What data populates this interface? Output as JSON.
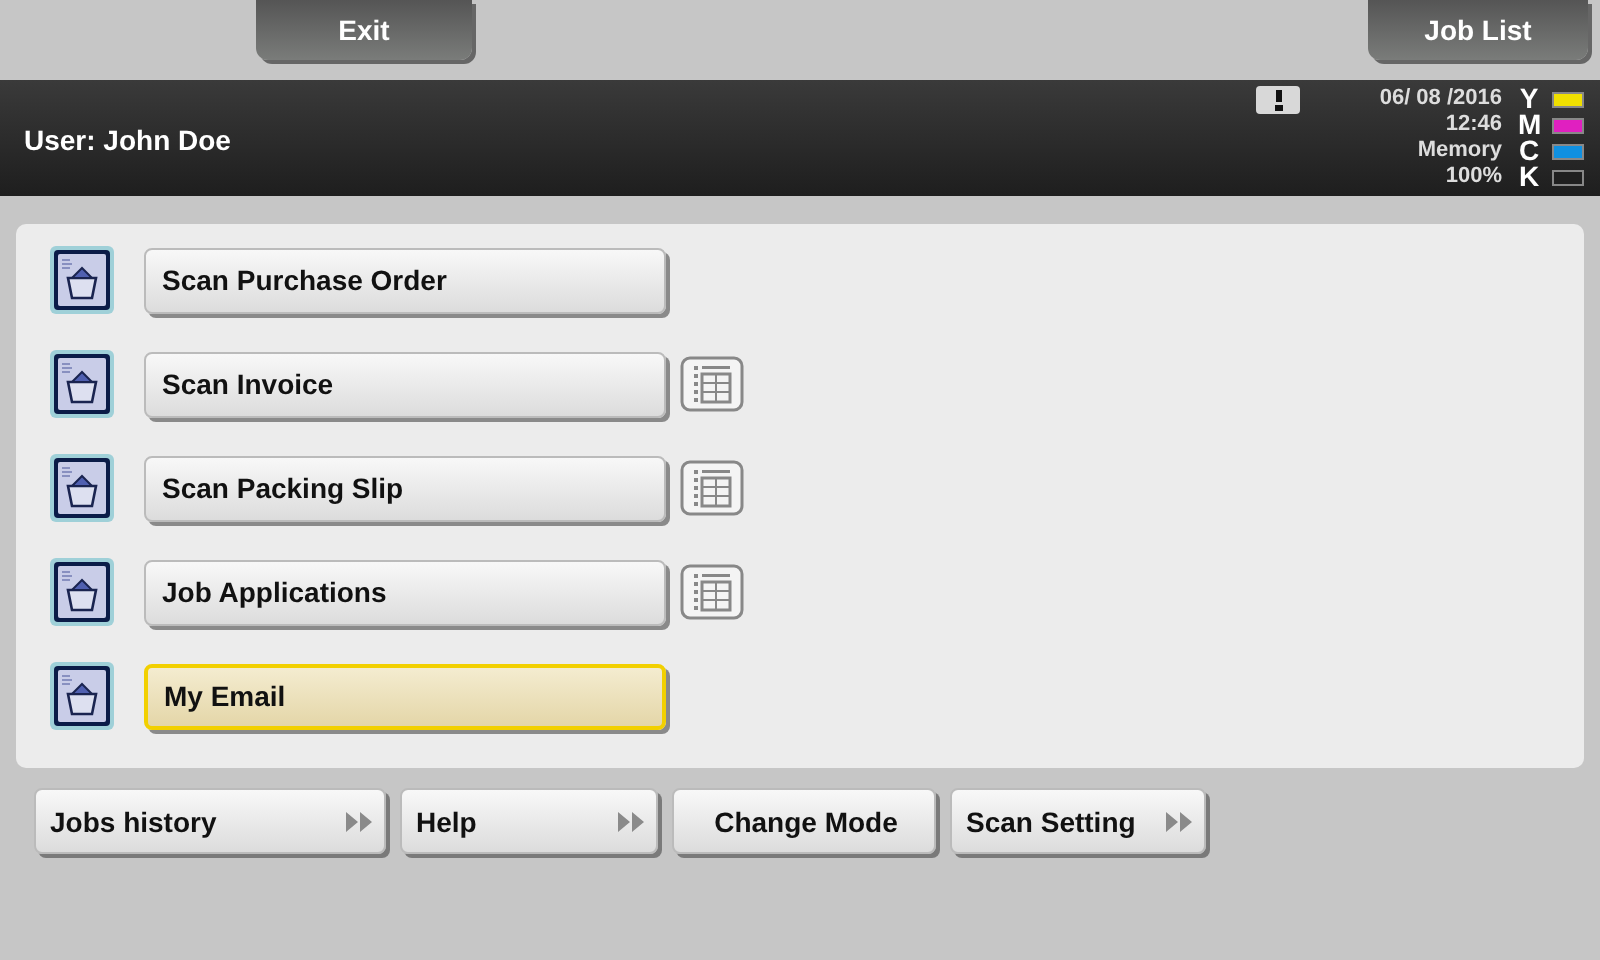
{
  "top_buttons": [
    {
      "label": "Exit"
    },
    {
      "label": "Job List"
    }
  ],
  "header": {
    "user": "User: John Doe",
    "alert": true,
    "date": "06/ 08 /2016",
    "time": "12:46",
    "memory_label": "Memory",
    "memory_value": "100%",
    "toners": [
      {
        "letter": "Y",
        "color": "#f0e000"
      },
      {
        "letter": "M",
        "color": "#e020c0"
      },
      {
        "letter": "C",
        "color": "#1090e0"
      },
      {
        "letter": "K",
        "color": "#202020"
      }
    ]
  },
  "apps": [
    {
      "label": "Scan Purchase Order",
      "kind": "plain",
      "selected": false
    },
    {
      "label": "Scan Invoice",
      "kind": "list",
      "selected": false
    },
    {
      "label": "Scan Packing Slip",
      "kind": "list",
      "selected": false
    },
    {
      "label": "Job Applications",
      "kind": "list",
      "selected": false
    },
    {
      "label": "My Email",
      "kind": "plain",
      "selected": true
    }
  ],
  "bottom_buttons": [
    {
      "label": "Jobs history",
      "kind": "submenu"
    },
    {
      "label": "Help",
      "kind": "submenu"
    },
    {
      "label": "Change Mode",
      "kind": "plain"
    },
    {
      "label": "Scan Setting",
      "kind": "submenu"
    }
  ]
}
